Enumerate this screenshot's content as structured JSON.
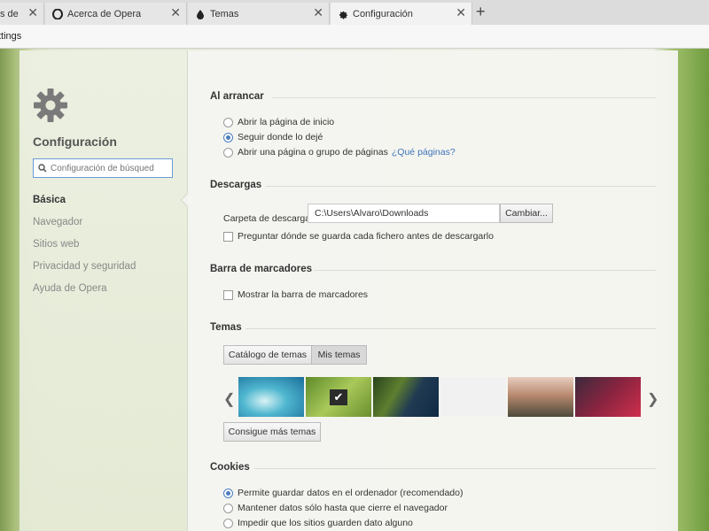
{
  "tabs": [
    {
      "label": "s de",
      "active": false
    },
    {
      "label": "Acerca de Opera",
      "active": false
    },
    {
      "label": "Temas",
      "active": false
    },
    {
      "label": "Configuración",
      "active": true
    }
  ],
  "address": {
    "url": "ttings"
  },
  "sidebar": {
    "title": "Configuración",
    "search_placeholder": "Configuración de búsqued",
    "items": [
      {
        "label": "Básica",
        "active": true
      },
      {
        "label": "Navegador"
      },
      {
        "label": "Sitios web"
      },
      {
        "label": "Privacidad y seguridad"
      },
      {
        "label": "Ayuda de Opera"
      }
    ]
  },
  "startup": {
    "heading": "Al arrancar",
    "options": [
      {
        "label": "Abrir la página de inicio",
        "checked": false
      },
      {
        "label": "Seguir donde lo dejé",
        "checked": true
      },
      {
        "label": "Abrir una página o grupo de páginas",
        "checked": false,
        "link": "¿Qué páginas?"
      }
    ]
  },
  "downloads": {
    "heading": "Descargas",
    "folder_label": "Carpeta de descarga:",
    "folder_value": "C:\\Users\\Alvaro\\Downloads",
    "change_button": "Cambiar...",
    "ask_label": "Preguntar dónde se guarda cada fichero antes de descargarlo"
  },
  "bookmarks": {
    "heading": "Barra de marcadores",
    "show_label": "Mostrar la barra de marcadores"
  },
  "themes": {
    "heading": "Temas",
    "tabs": [
      "Catálogo de temas",
      "Mis temas"
    ],
    "active_tab": "Mis temas",
    "more_button": "Consigue más temas",
    "selected_index": 1
  },
  "cookies": {
    "heading": "Cookies",
    "options": [
      {
        "label": "Permite guardar datos en el ordenador (recomendado)",
        "checked": true
      },
      {
        "label": "Mantener datos sólo hasta que cierre el navegador",
        "checked": false
      },
      {
        "label": "Impedir que los sitios guarden dato alguno",
        "checked": false
      }
    ]
  },
  "colors": {
    "accent": "#4a7cc0",
    "link": "#3d74b8"
  }
}
